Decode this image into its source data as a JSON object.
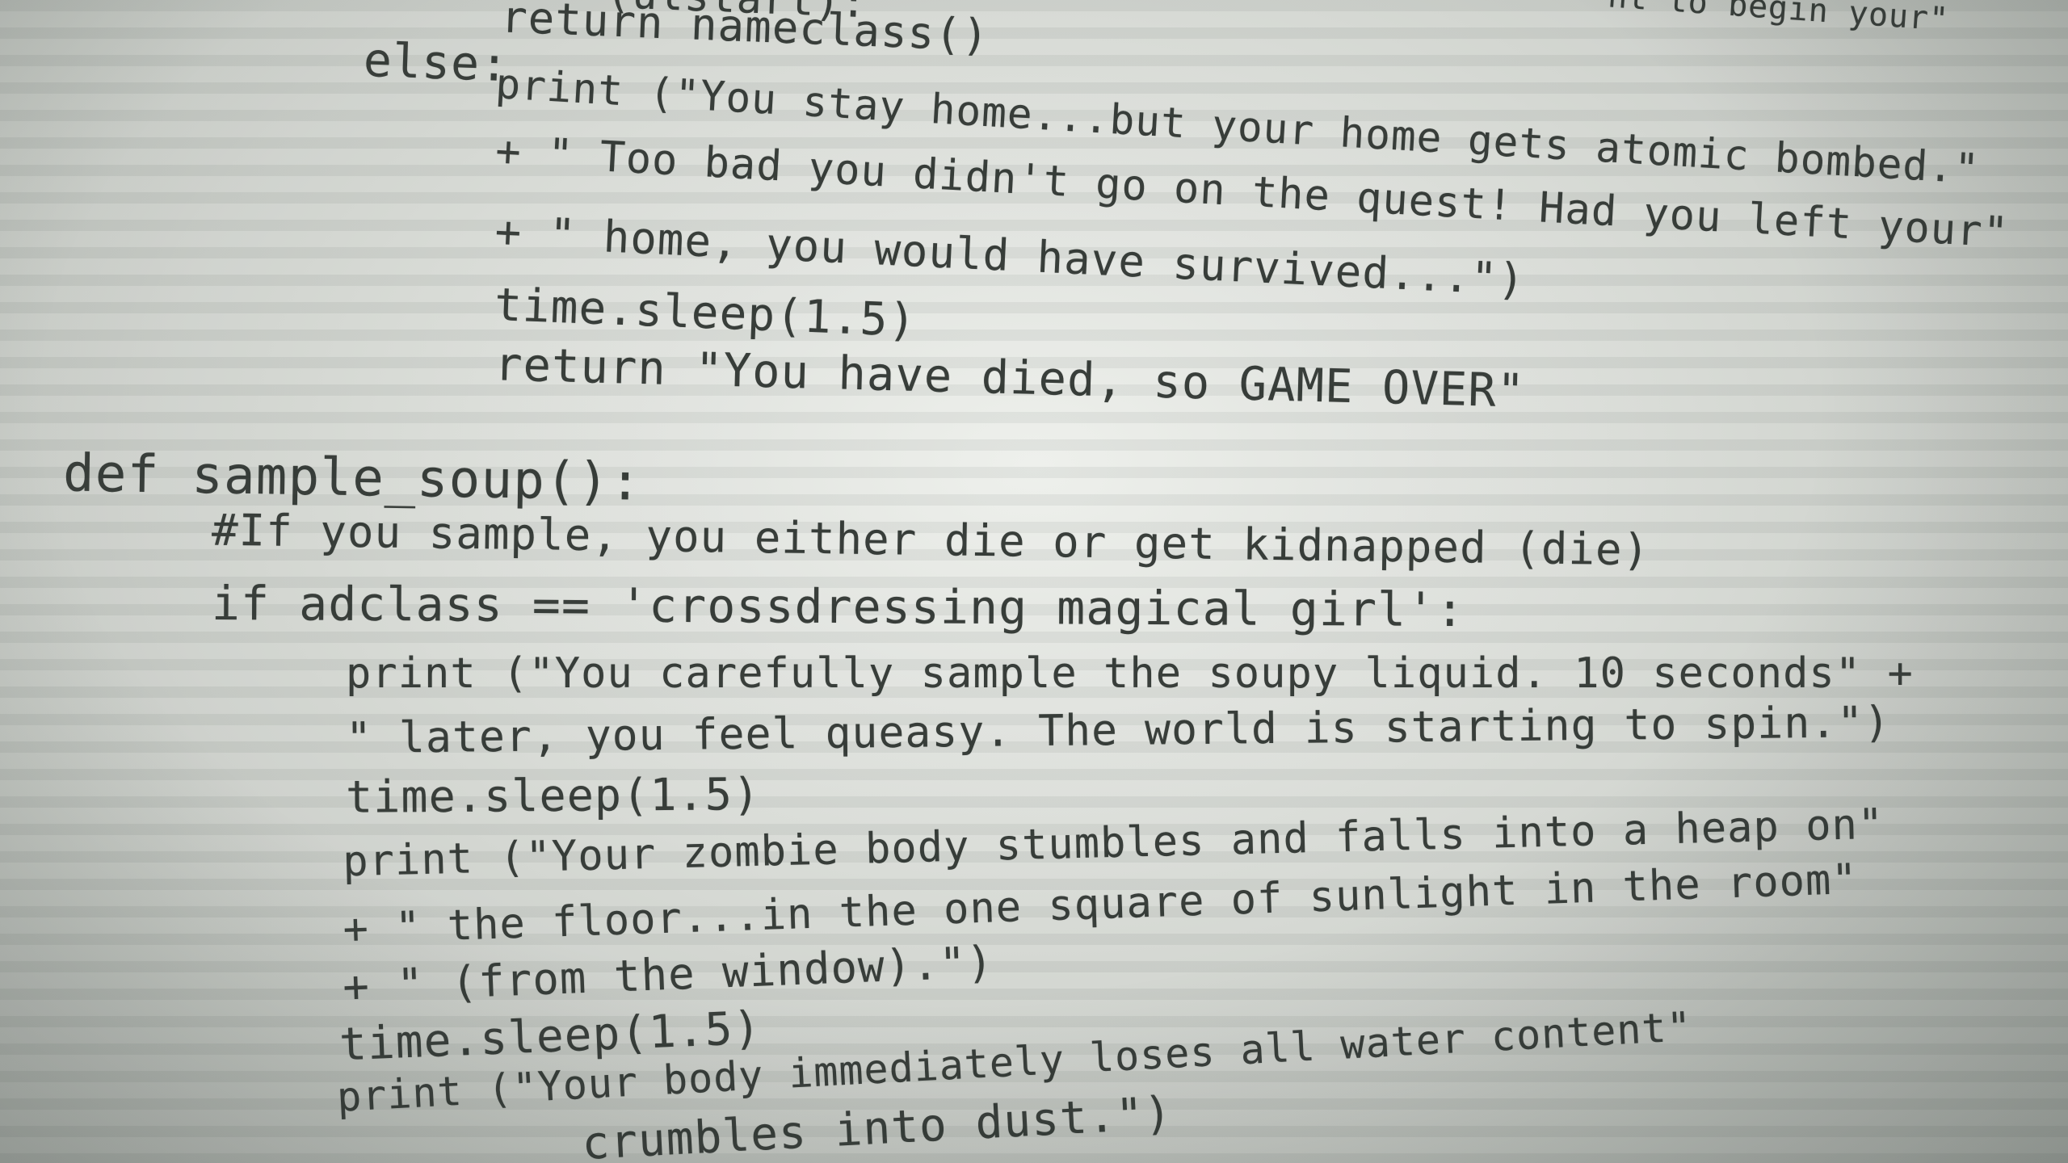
{
  "code_lines": [
    {
      "id": "top-right",
      "text": "nt to begin your\""
    },
    {
      "id": "l0",
      "text": "(ulstart):"
    },
    {
      "id": "l1",
      "text": "return nameclass()"
    },
    {
      "id": "l2",
      "text": "else:"
    },
    {
      "id": "l3",
      "text": "print (\"You stay home...but your home gets atomic bombed.\""
    },
    {
      "id": "l4",
      "text": "+ \" Too bad you didn't go on the quest! Had you left your\""
    },
    {
      "id": "l5",
      "text": "+ \" home, you would have survived...\")"
    },
    {
      "id": "l6",
      "text": "time.sleep(1.5)"
    },
    {
      "id": "l7",
      "text": "return \"You have died, so GAME OVER\""
    },
    {
      "id": "l8",
      "text": "def sample_soup():"
    },
    {
      "id": "l9",
      "text": "#If you sample, you either die or get kidnapped (die)"
    },
    {
      "id": "l10",
      "text": "if adclass == 'crossdressing magical girl':"
    },
    {
      "id": "l11",
      "text": "print (\"You carefully sample the soupy liquid. 10 seconds\" +"
    },
    {
      "id": "l12",
      "text": "\" later, you feel queasy. The world is starting to spin.\")"
    },
    {
      "id": "l13",
      "text": "time.sleep(1.5)"
    },
    {
      "id": "l14",
      "text": "print (\"Your zombie body stumbles and falls into a heap on\""
    },
    {
      "id": "l15",
      "text": "+ \" the floor...in the one square of sunlight in the room\""
    },
    {
      "id": "l16",
      "text": "+ \" (from the window).\")"
    },
    {
      "id": "l17",
      "text": "time.sleep(1.5)"
    },
    {
      "id": "l18",
      "text": "print (\"Your body immediately loses all water content\""
    },
    {
      "id": "l19",
      "text": "crumbles into dust.\")"
    }
  ]
}
